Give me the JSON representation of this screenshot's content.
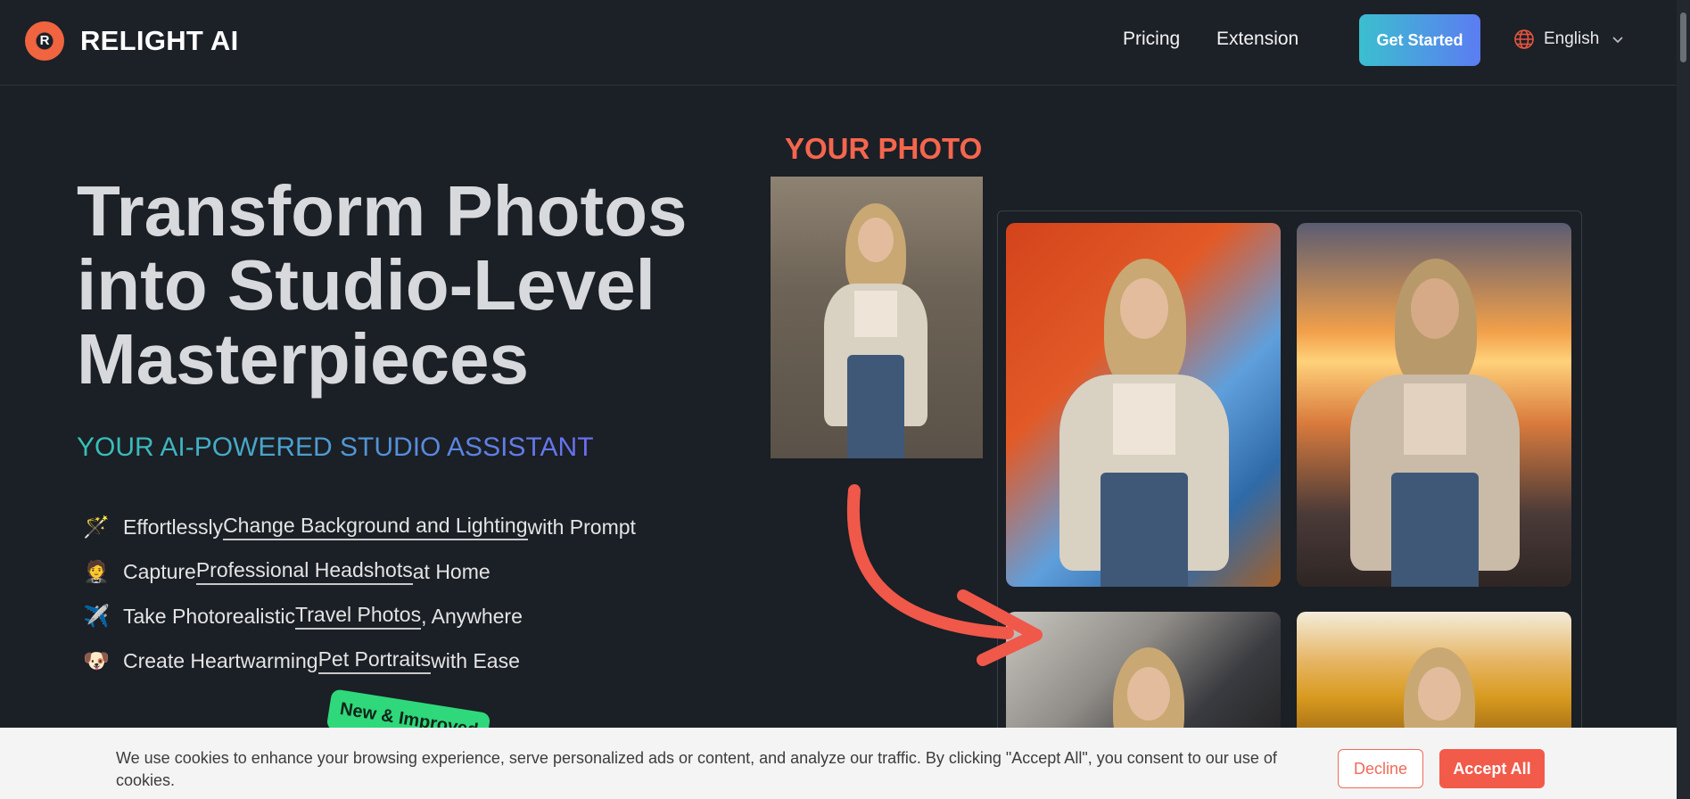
{
  "header": {
    "brand": "RELIGHT AI",
    "nav": {
      "pricing": "Pricing",
      "extension": "Extension"
    },
    "cta": "Get Started",
    "language": "English"
  },
  "hero": {
    "title_line1": "Transform Photos",
    "title_line2": "into Studio-Level",
    "title_line3": "Masterpieces",
    "subtitle": "YOUR AI-POWERED STUDIO ASSISTANT",
    "features": [
      {
        "emoji": "🪄",
        "before": "Effortlessly ",
        "link": "Change Background and Lighting",
        "after": " with Prompt"
      },
      {
        "emoji": "🤵",
        "before": "Capture ",
        "link": "Professional Headshots",
        "after": " at Home"
      },
      {
        "emoji": "✈️",
        "before": "Take Photorealistic ",
        "link": "Travel Photos",
        "after": ", Anywhere"
      },
      {
        "emoji": "🐶",
        "before": "Create Heartwarming ",
        "link": "Pet Portraits",
        "after": " with Ease"
      }
    ],
    "badge": "New & Improved"
  },
  "showcase": {
    "your_photo_label": "YOUR PHOTO"
  },
  "cookie": {
    "text": "We use cookies to enhance your browsing experience, serve personalized ads or content, and analyze our traffic. By clicking \"Accept All\", you consent to our use of cookies.",
    "decline": "Decline",
    "accept": "Accept All"
  },
  "colors": {
    "accent": "#f4664d",
    "cta_gradient_start": "#3bbfcf",
    "cta_gradient_end": "#5c7cf2",
    "background": "#1b1f26"
  }
}
